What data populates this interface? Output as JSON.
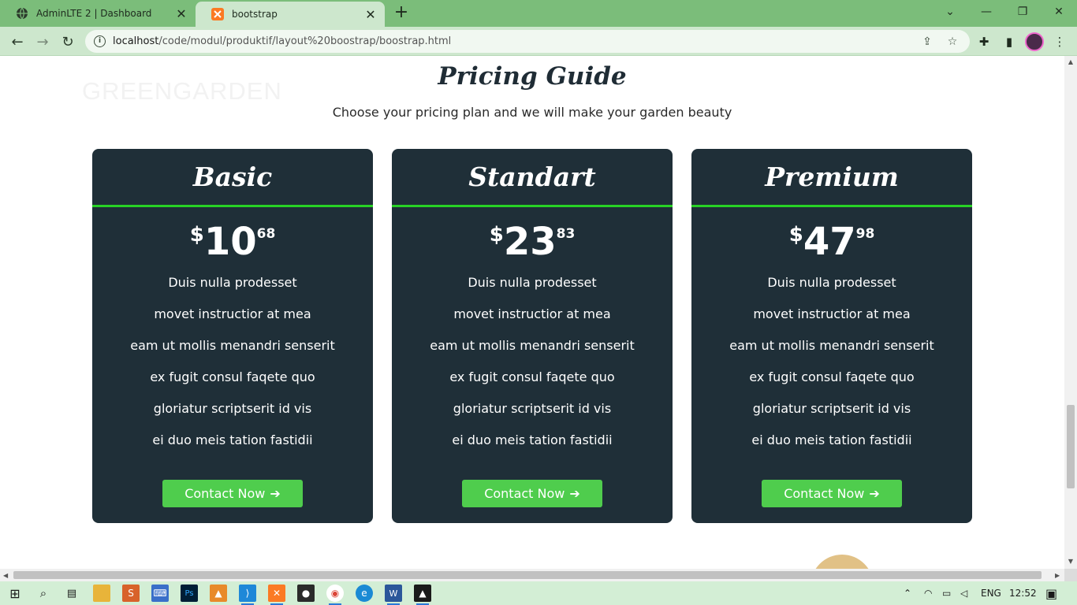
{
  "browser": {
    "tabs": [
      {
        "title": "AdminLTE 2 | Dashboard",
        "icon": "globe-icon",
        "active": false
      },
      {
        "title": "bootstrap",
        "icon": "xampp-icon",
        "active": true
      }
    ],
    "new_tab": "+",
    "url_host": "localhost",
    "url_path": "/code/modul/produktif/layout%20boostrap/boostrap.html"
  },
  "page": {
    "brand": "GREENGARDEN",
    "title": "Pricing Guide",
    "subtitle": "Choose your pricing plan and we will make your garden beauty",
    "plans": [
      {
        "name": "Basic",
        "currency": "$",
        "whole": "10",
        "cents": "68",
        "features": [
          "Duis nulla prodesset",
          "movet instructior at mea",
          "eam ut mollis menandri senserit",
          "ex fugit consul faqete quo",
          "gloriatur scriptserit id vis",
          "ei duo meis tation fastidii"
        ],
        "cta": "Contact Now"
      },
      {
        "name": "Standart",
        "currency": "$",
        "whole": "23",
        "cents": "83",
        "features": [
          "Duis nulla prodesset",
          "movet instructior at mea",
          "eam ut mollis menandri senserit",
          "ex fugit consul faqete quo",
          "gloriatur scriptserit id vis",
          "ei duo meis tation fastidii"
        ],
        "cta": "Contact Now"
      },
      {
        "name": "Premium",
        "currency": "$",
        "whole": "47",
        "cents": "98",
        "features": [
          "Duis nulla prodesset",
          "movet instructior at mea",
          "eam ut mollis menandri senserit",
          "ex fugit consul faqete quo",
          "gloriatur scriptserit id vis",
          "ei duo meis tation fastidii"
        ],
        "cta": "Contact Now"
      }
    ],
    "colors": {
      "card_bg": "#1f2f38",
      "accent_line": "#28d226",
      "button": "#4fcd4d"
    }
  },
  "taskbar": {
    "lang": "ENG",
    "time": "12:52"
  }
}
